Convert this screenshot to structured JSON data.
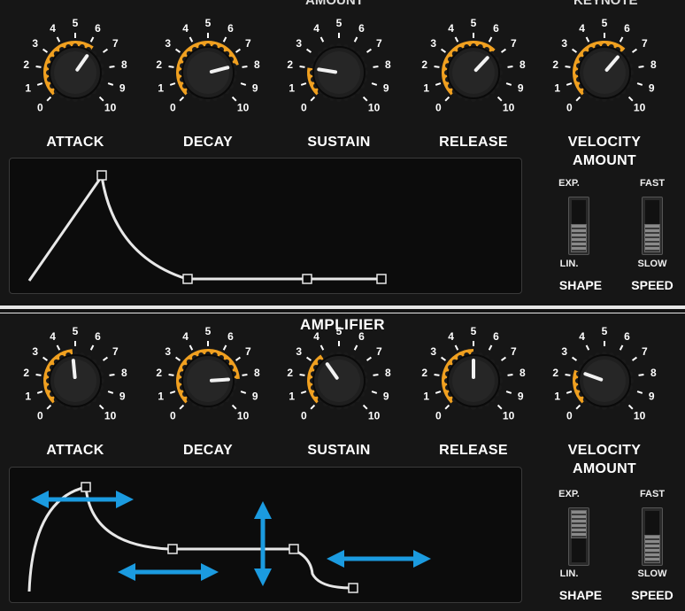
{
  "filter": {
    "partial_top_left": "AMOUNT",
    "partial_top_right": "KEYNOTE",
    "knobs": [
      {
        "label": "ATTACK",
        "value": 6.3
      },
      {
        "label": "DECAY",
        "value": 7.8
      },
      {
        "label": "SUSTAIN",
        "value": 2.0
      },
      {
        "label": "RELEASE",
        "value": 6.6
      },
      {
        "label": "VELOCITY",
        "label2": "AMOUNT",
        "value": 6.5
      }
    ],
    "shape_switch": {
      "top": "EXP.",
      "bottom": "LIN.",
      "name": "SHAPE",
      "position": "bottom"
    },
    "speed_switch": {
      "top": "FAST",
      "bottom": "SLOW",
      "name": "SPEED",
      "position": "bottom"
    }
  },
  "amplifier": {
    "title": "AMPLIFIER",
    "knobs": [
      {
        "label": "ATTACK",
        "value": 4.8
      },
      {
        "label": "DECAY",
        "value": 8.2
      },
      {
        "label": "SUSTAIN",
        "value": 3.7
      },
      {
        "label": "RELEASE",
        "value": 5.0
      },
      {
        "label": "VELOCITY",
        "label2": "AMOUNT",
        "value": 2.4
      }
    ],
    "shape_switch": {
      "top": "EXP.",
      "bottom": "LIN.",
      "name": "SHAPE",
      "position": "top"
    },
    "speed_switch": {
      "top": "FAST",
      "bottom": "SLOW",
      "name": "SPEED",
      "position": "bottom"
    }
  },
  "scale_labels": [
    "0",
    "1",
    "2",
    "3",
    "4",
    "5",
    "6",
    "7",
    "8",
    "9",
    "10"
  ],
  "colors": {
    "accent_arc": "#f0a020",
    "annotation_arrow": "#1b9be0",
    "curve": "#e8e8e8"
  }
}
